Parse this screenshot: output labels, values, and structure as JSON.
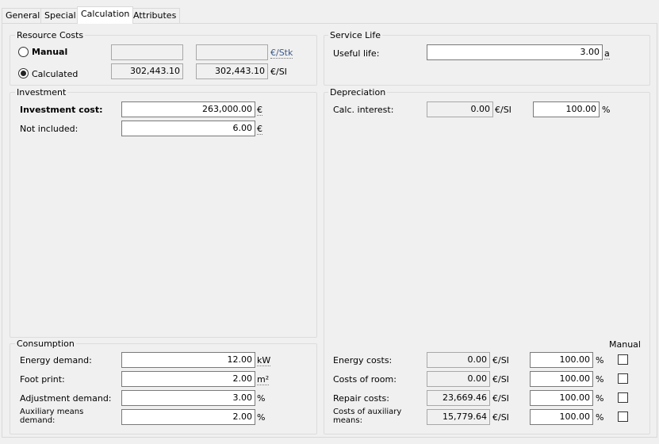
{
  "tabs": [
    "General",
    "Special",
    "Calculation",
    "Attributes"
  ],
  "resource_costs": {
    "title": "Resource Costs",
    "manual_label": "Manual",
    "calculated_label": "Calculated",
    "manual_value_1": "",
    "manual_value_2": "",
    "manual_unit": "€/Stk",
    "calculated_value_1": "302,443.10",
    "calculated_value_2": "302,443.10",
    "calculated_unit": "€/SI"
  },
  "service_life": {
    "title": "Service Life",
    "useful_life_label": "Useful life:",
    "useful_life_value": "3.00",
    "useful_life_unit": "a"
  },
  "investment": {
    "title": "Investment",
    "cost_label": "Investment cost:",
    "cost_value": "263,000.00",
    "cost_unit": "€",
    "not_included_label": "Not included:",
    "not_included_value": "6.00",
    "not_included_unit": "€"
  },
  "depreciation": {
    "title": "Depreciation",
    "calc_interest_label": "Calc. interest:",
    "calc_interest_value": "0.00",
    "calc_interest_unit": "€/SI",
    "calc_interest_pct": "100.00",
    "pct_unit": "%"
  },
  "consumption": {
    "title": "Consumption",
    "energy_label": "Energy demand:",
    "energy_value": "12.00",
    "energy_unit": "kW",
    "footprint_label": "Foot print:",
    "footprint_value": "2.00",
    "footprint_unit": "m²",
    "adjustment_label": "Adjustment demand:",
    "adjustment_value": "3.00",
    "adjustment_unit": "%",
    "auxiliary_label": "Auxiliary means demand:",
    "auxiliary_value": "2.00",
    "auxiliary_unit": "%"
  },
  "costs": {
    "manual_header": "Manual",
    "energy_costs_label": "Energy costs:",
    "energy_costs_value": "0.00",
    "energy_costs_pct": "100.00",
    "room_label": "Costs of room:",
    "room_value": "0.00",
    "room_pct": "100.00",
    "repair_label": "Repair costs:",
    "repair_value": "23,669.46",
    "repair_pct": "100.00",
    "aux_label": "Costs of auxiliary means:",
    "aux_value": "15,779.64",
    "aux_pct": "100.00",
    "unit": "€/SI",
    "pct_unit": "%"
  }
}
